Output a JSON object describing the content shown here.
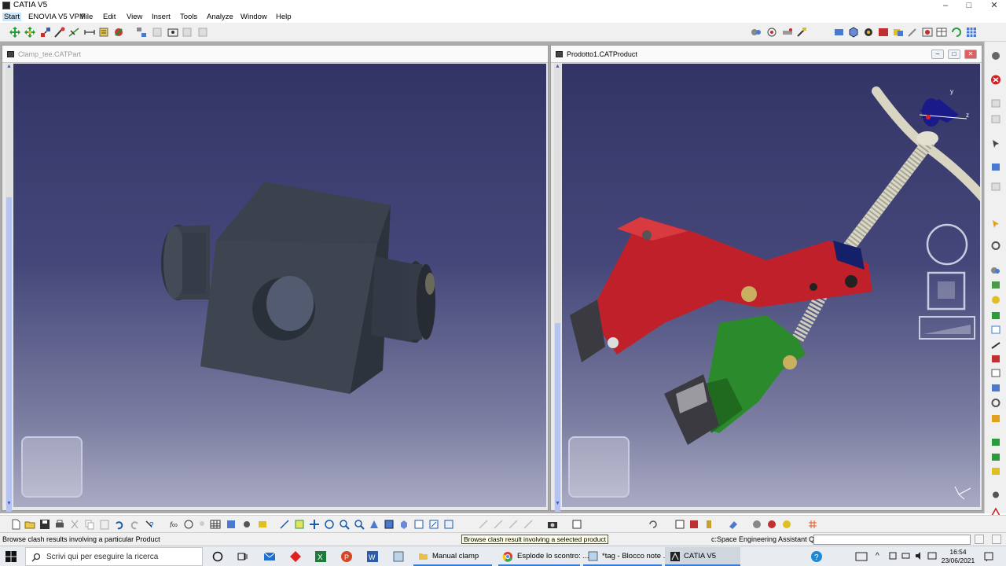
{
  "window": {
    "title": "CATIA V5",
    "controls": [
      "–",
      "□",
      "✕"
    ]
  },
  "menu": [
    "Start",
    "ENOVIA V5 VPM",
    "File",
    "Edit",
    "View",
    "Insert",
    "Tools",
    "Analyze",
    "Window",
    "Help"
  ],
  "doc_left": {
    "title": "Clamp_tee.CATPart"
  },
  "doc_right": {
    "title": "Prodotto1.CATProduct",
    "buttons": [
      "–",
      "□",
      "✕"
    ]
  },
  "compass_axes": {
    "y": "y",
    "z": "z"
  },
  "status": {
    "message": "Browse clash results involving a particular Product",
    "tooltip": "Browse clash result involving a selected product",
    "query_label": "c:Space Engineering Assistant Query",
    "query_value": ""
  },
  "taskbar": {
    "search_placeholder": "Scrivi qui per eseguire la ricerca",
    "tasks": [
      "Manual clamp",
      "Esplode lo scontro: ...",
      "*tag - Blocco note ...",
      "CATIA V5"
    ],
    "time": "16:54",
    "date": "23/06/2021"
  },
  "colors": {
    "viewport_top": "#333466",
    "viewport_bottom": "#a9abc4",
    "part_gray": "#3d4450",
    "red_arm": "#c0202a",
    "green_jaw": "#2b8a2b",
    "screw": "#d9d7c6"
  },
  "icons": {
    "toolbar": [
      "move-icon",
      "snap-icon",
      "explode-icon",
      "clash-icon",
      "sectioning-icon",
      "distance-icon",
      "catalog-icon",
      "product-icon"
    ],
    "bottom": [
      "new-icon",
      "open-icon",
      "save-icon",
      "print-icon",
      "cut-icon",
      "copy-icon",
      "paste-icon",
      "undo-icon",
      "redo-icon",
      "help-icon",
      "fly-icon",
      "fit-all-icon",
      "pan-icon",
      "rotate-icon",
      "zoom-in-icon",
      "zoom-out-icon",
      "normal-view-icon",
      "iso-view-icon",
      "shading-icon",
      "hide-show-icon"
    ]
  }
}
